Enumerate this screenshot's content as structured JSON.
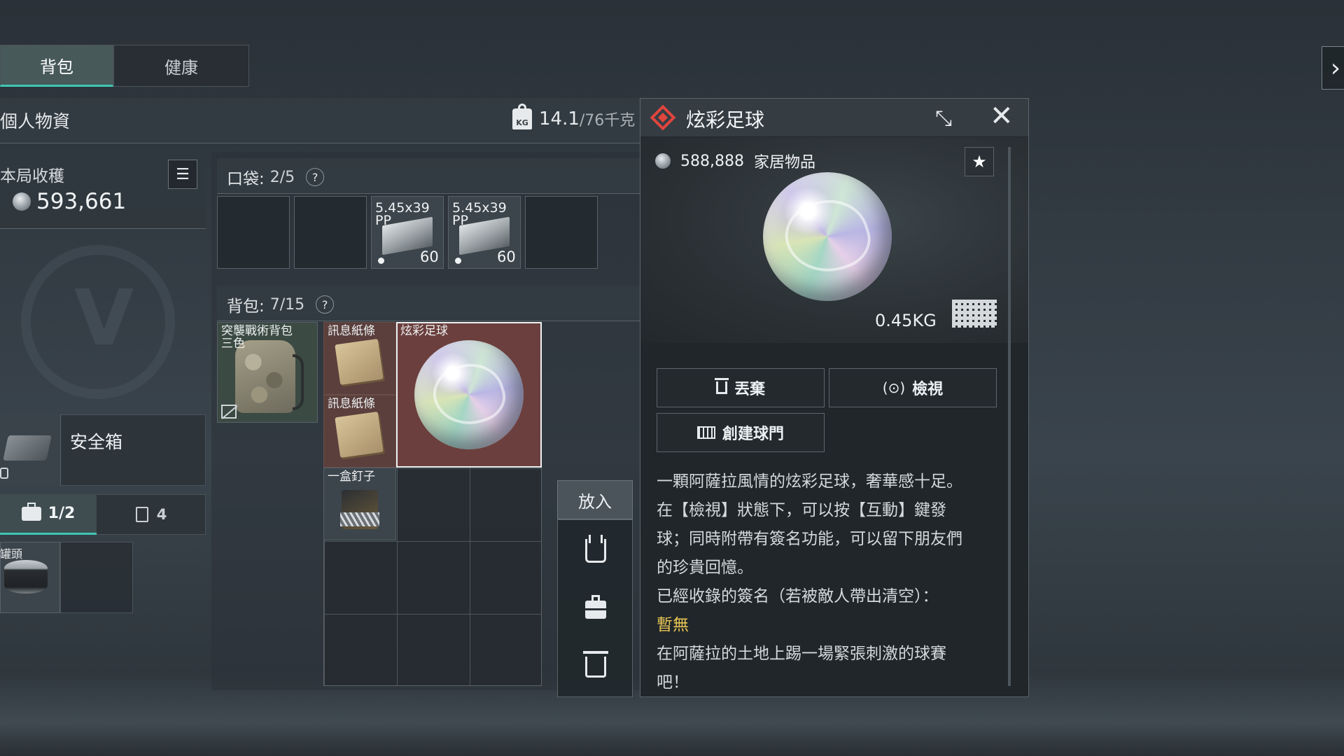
{
  "tabs": [
    {
      "label": "背包",
      "active": true
    },
    {
      "label": "健康",
      "active": false
    }
  ],
  "header": {
    "title": "個人物資",
    "weight_current": "14.1",
    "weight_total": "/76千克"
  },
  "loot": {
    "label": "本局收穫",
    "value": "593,661"
  },
  "safebox": {
    "label": "安全箱"
  },
  "subtabs": {
    "case_count": "1/2",
    "bin_count": "4"
  },
  "canned": {
    "label": "罐頭"
  },
  "pocket": {
    "label": "口袋:",
    "count": "2/5",
    "help": "?",
    "items": [
      {
        "label": "5.45x39",
        "sub": "PP",
        "count": "60"
      },
      {
        "label": "5.45x39",
        "sub": "PP",
        "count": "60"
      }
    ]
  },
  "backpack": {
    "label": "背包:",
    "count": "7/15",
    "help": "?",
    "items": {
      "bag": "突襲戰術背包",
      "bag_sub": "三色",
      "note1": "訊息紙條",
      "note2": "訊息紙條",
      "nails": "一盒釘子",
      "ball": "炫彩足球"
    }
  },
  "side": {
    "put_in": "放入"
  },
  "detail": {
    "title": "炫彩足球",
    "price": "588,888",
    "category": "家居物品",
    "weight": "0.45KG",
    "buttons": {
      "discard": "丟棄",
      "inspect": "檢視",
      "create_goal": "創建球門"
    },
    "description_lines": [
      "一顆阿薩拉風情的炫彩足球，奢華感十足。",
      "在【檢視】狀態下，可以按【互動】鍵發",
      "球；同時附帶有簽名功能，可以留下朋友們",
      "的珍貴回憶。",
      "已經收錄的簽名（若被敵人帶出清空）："
    ],
    "signature_value": "暫無",
    "flavor_lines": [
      "在阿薩拉的土地上踢一場緊張刺激的球賽",
      "吧！"
    ]
  },
  "colors": {
    "accent": "#3fc7b4",
    "rarity": "#e0453e",
    "selected_slot": "#6b3f3d",
    "highlight_text": "#e7c453"
  },
  "icons": [
    "list-icon",
    "coin-icon",
    "weight-bag-icon",
    "lock-icon",
    "briefcase-icon",
    "bin-icon",
    "help-icon",
    "no-secure-icon",
    "vest-icon",
    "trash-icon",
    "shrink-icon",
    "close-icon",
    "star-icon",
    "eye-icon",
    "goal-icon",
    "size-grid-icon",
    "chevron-right-icon"
  ]
}
